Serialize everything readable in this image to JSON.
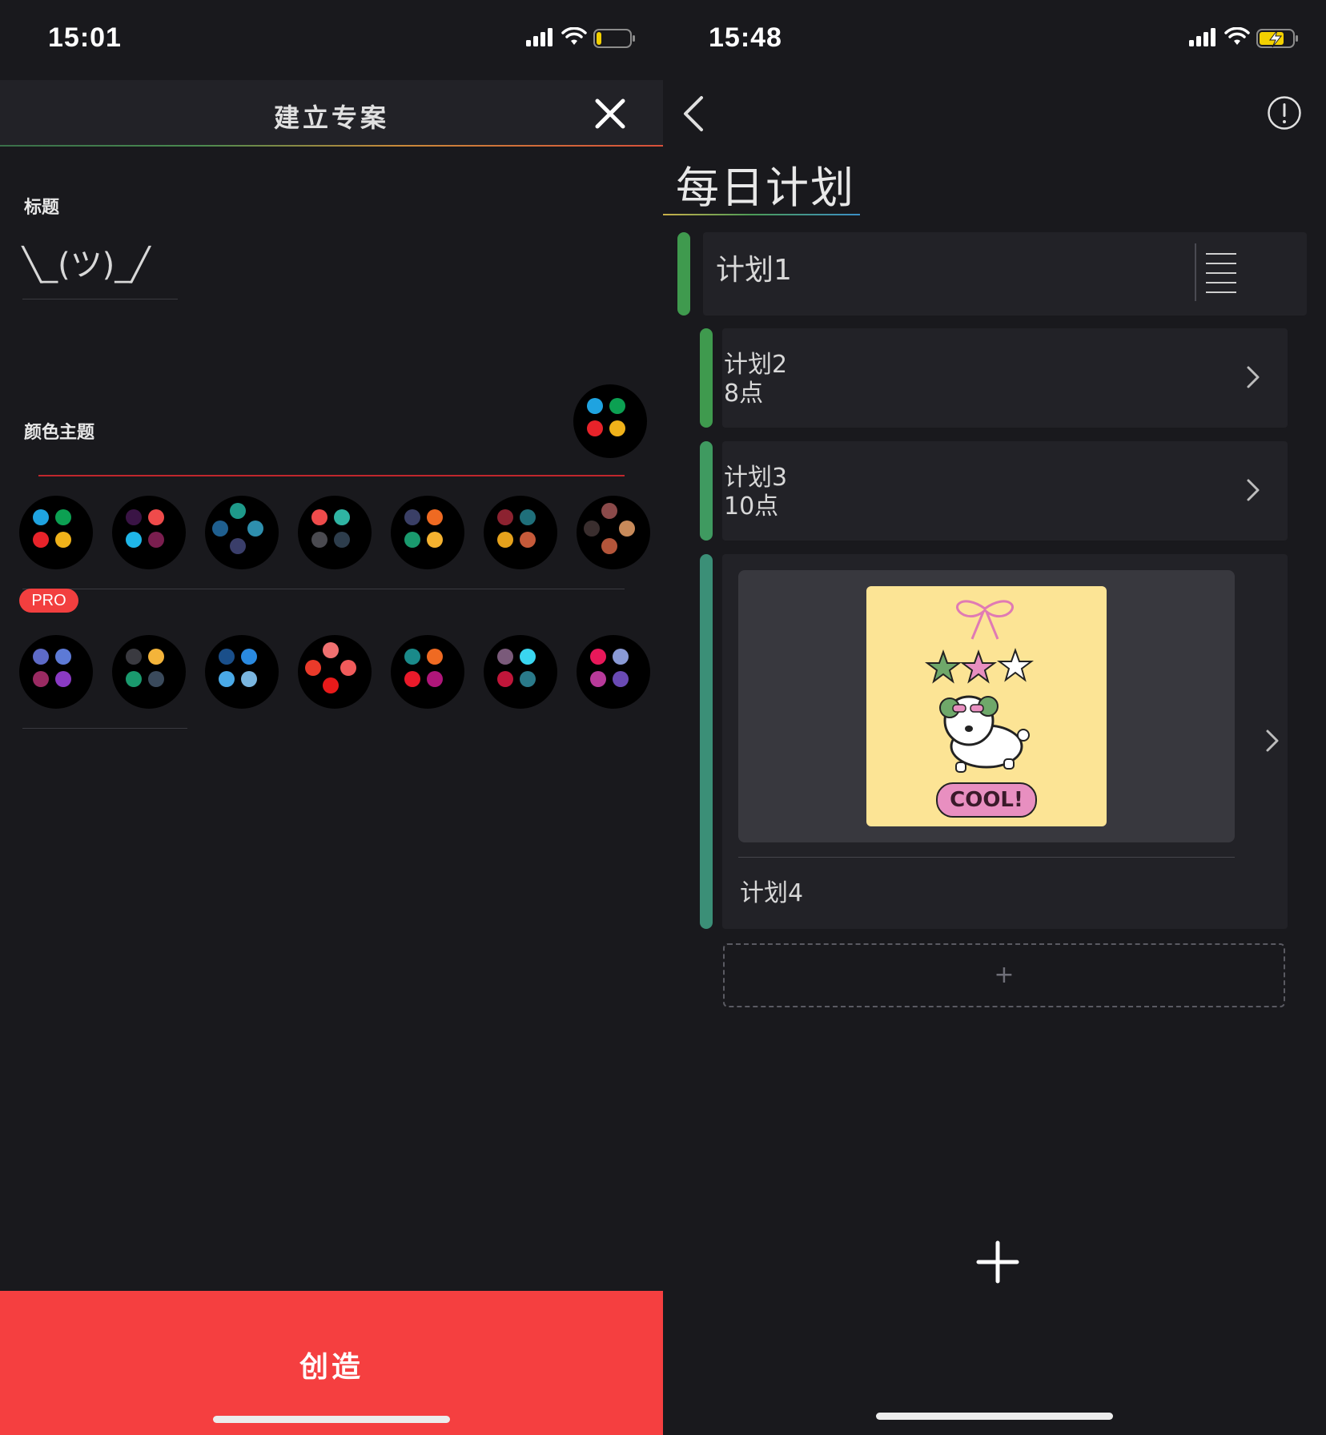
{
  "left": {
    "status": {
      "time": "15:01"
    },
    "header": {
      "title": "建立专案"
    },
    "title_section": {
      "label": "标题",
      "value": "╲_(ツ)_╱"
    },
    "theme_section": {
      "label": "颜色主题",
      "pro_badge": "PRO"
    },
    "themes_free": [
      [
        "#1fa3e0",
        "#0ca052",
        "#e8232a",
        "#f0b21a"
      ],
      [
        "#3a1445",
        "#ef4b4b",
        "#1fb6e8",
        "#7a1e4f"
      ],
      [
        "#1e9a8a",
        "#1f5f8f",
        "#2e8fae",
        "#3a3e6a"
      ],
      [
        "#ef4b4b",
        "#2fb4a3",
        "#4a4a50",
        "#2d3d4c"
      ],
      [
        "#3a3f66",
        "#ef6a22",
        "#1a9a6e",
        "#f5b230"
      ],
      [
        "#8c2230",
        "#1f6f7a",
        "#e6a21c",
        "#c65a3a"
      ],
      [
        "#8b4a4a",
        "#3a2e2e",
        "#c88a5a",
        "#b4553a"
      ]
    ],
    "themes_pro": [
      [
        "#5d6ac7",
        "#5d7ad6",
        "#9a2a62",
        "#8a3ac4"
      ],
      [
        "#3a3a40",
        "#f4b43a",
        "#1a9a6e",
        "#3a4a5c"
      ],
      [
        "#1a4f8a",
        "#2a8ae0",
        "#4aaae8",
        "#7ab6e0"
      ],
      [
        "#f07070",
        "#ea3a2a",
        "#f05a5a",
        "#e81a1a"
      ],
      [
        "#1a8a8a",
        "#ef6a22",
        "#ea1a2a",
        "#b0167a"
      ],
      [
        "#7a5a7a",
        "#3ad6f0",
        "#c0163a",
        "#2a7a8a"
      ],
      [
        "#e8185a",
        "#8a9ad6",
        "#b83a9a",
        "#6a4ab4"
      ]
    ],
    "create_button": "创造",
    "preview_dots": [
      "#1fa3e0",
      "#0ca052",
      "#e8232a",
      "#f0b21a"
    ]
  },
  "right": {
    "status": {
      "time": "15:48"
    },
    "title": "每日计划",
    "plans": [
      {
        "name": "计划1",
        "color": "#3f9a4e"
      },
      {
        "name": "计划2",
        "sub": "8点",
        "color": "#3f9a4e"
      },
      {
        "name": "计划3",
        "sub": "10点",
        "color": "#3f9a60"
      },
      {
        "name": "计划4",
        "color": "#3b8f77"
      }
    ],
    "sticker_text": "COOL!",
    "add_card": "+"
  }
}
